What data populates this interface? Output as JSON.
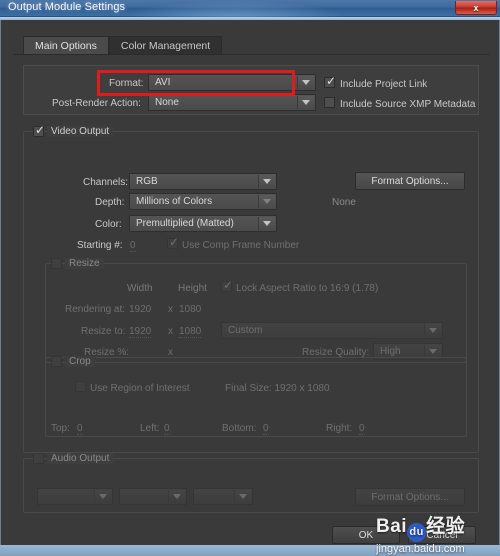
{
  "window": {
    "title": "Output Module Settings",
    "close_label": "x",
    "close_icon": "close-icon"
  },
  "tabs": [
    {
      "label": "Main Options",
      "active": true
    },
    {
      "label": "Color Management",
      "active": false
    }
  ],
  "format_section": {
    "format_label": "Format:",
    "format_value": "AVI",
    "post_render_label": "Post-Render Action:",
    "post_render_value": "None",
    "include_project_link_label": "Include Project Link",
    "include_project_link_checked": true,
    "include_xmp_label": "Include Source XMP Metadata",
    "include_xmp_checked": false,
    "highlight_color": "#e01b1b"
  },
  "video_output": {
    "group_label": "Video Output",
    "checked": true,
    "channels_label": "Channels:",
    "channels_value": "RGB",
    "depth_label": "Depth:",
    "depth_value": "Millions of Colors",
    "color_label": "Color:",
    "color_value": "Premultiplied (Matted)",
    "starting_label": "Starting #:",
    "starting_value": "0",
    "use_comp_frame_label": "Use Comp Frame Number",
    "use_comp_frame_checked": true,
    "format_options_label": "Format Options...",
    "format_options_status": "None"
  },
  "resize": {
    "group_label": "Resize",
    "checked": false,
    "width_header": "Width",
    "height_header": "Height",
    "lock_aspect_label": "Lock Aspect Ratio to  16:9 (1.78)",
    "lock_aspect_checked": true,
    "rendering_at_label": "Rendering at:",
    "rendering_width": "1920",
    "rendering_x": "x",
    "rendering_height": "1080",
    "resize_to_label": "Resize to:",
    "resize_width": "1920",
    "resize_x": "x",
    "resize_height": "1080",
    "preset_value": "Custom",
    "resize_pct_label": "Resize %:",
    "resize_pct_x": "x",
    "resize_quality_label": "Resize Quality:",
    "resize_quality_value": "High"
  },
  "crop": {
    "group_label": "Crop",
    "checked": false,
    "use_roi_label": "Use Region of Interest",
    "use_roi_checked": false,
    "final_size_label": "Final Size: 1920 x 1080",
    "top_label": "Top:",
    "top_value": "0",
    "left_label": "Left:",
    "left_value": "0",
    "bottom_label": "Bottom:",
    "bottom_value": "0",
    "right_label": "Right:",
    "right_value": "0"
  },
  "audio_output": {
    "group_label": "Audio Output",
    "checked": false,
    "rate_value": "",
    "depth_value": "",
    "channels_value": "",
    "format_options_label": "Format Options..."
  },
  "footer": {
    "ok_label": "OK",
    "cancel_label": "Cancel"
  },
  "watermark": {
    "brand": "Bai",
    "brand2": "du",
    "suffix": "经验",
    "url": "jingyan.baidu.com"
  }
}
